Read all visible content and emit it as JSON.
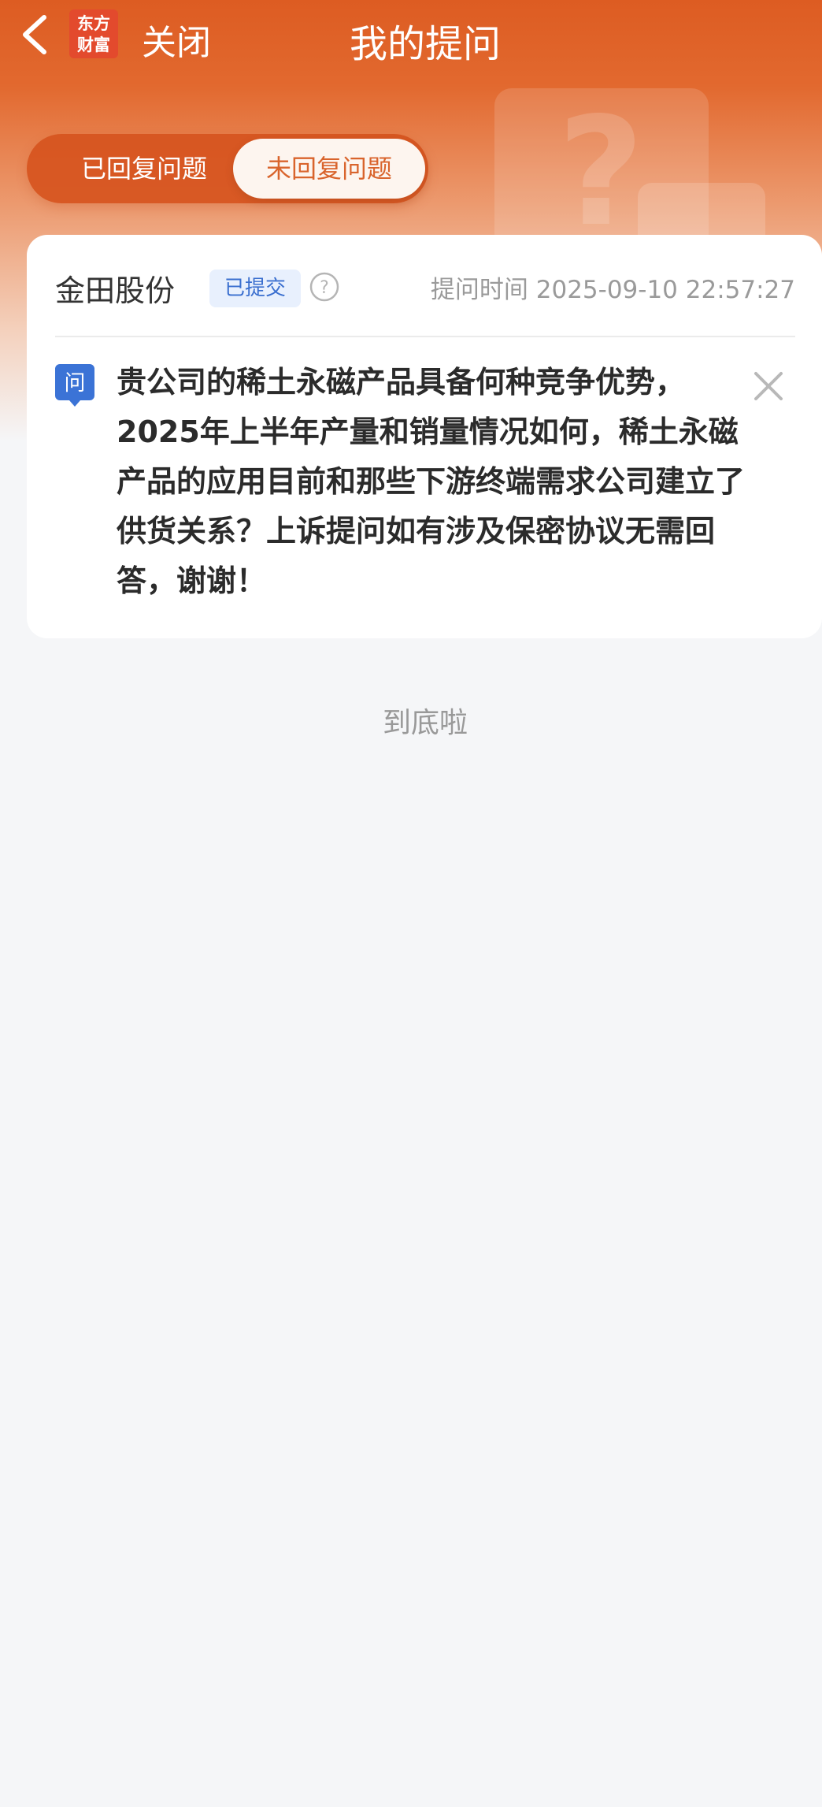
{
  "header": {
    "logo_line1": "东方",
    "logo_line2": "财富",
    "close_label": "关闭",
    "title": "我的提问"
  },
  "tabs": [
    {
      "label": "已回复问题",
      "selected": false
    },
    {
      "label": "未回复问题",
      "selected": true
    }
  ],
  "question_card": {
    "company": "金田股份",
    "status": "已提交",
    "time_label": "提问时间",
    "time": "2025-09-10 22:57:27",
    "question_badge": "问",
    "question_text": "贵公司的稀土永磁产品具备何种竞争优势，2025年上半年产量和销量情况如何，稀土永磁产品的应用目前和那些下游终端需求公司建立了供货关系？上诉提问如有涉及保密协议无需回答，谢谢！"
  },
  "list_end_text": "到底啦",
  "colors": {
    "brand_orange": "#dd5c22",
    "tab_selected_text": "#d9642c",
    "badge_blue": "#3a6fcf",
    "question_icon_blue": "#3b73d6"
  }
}
